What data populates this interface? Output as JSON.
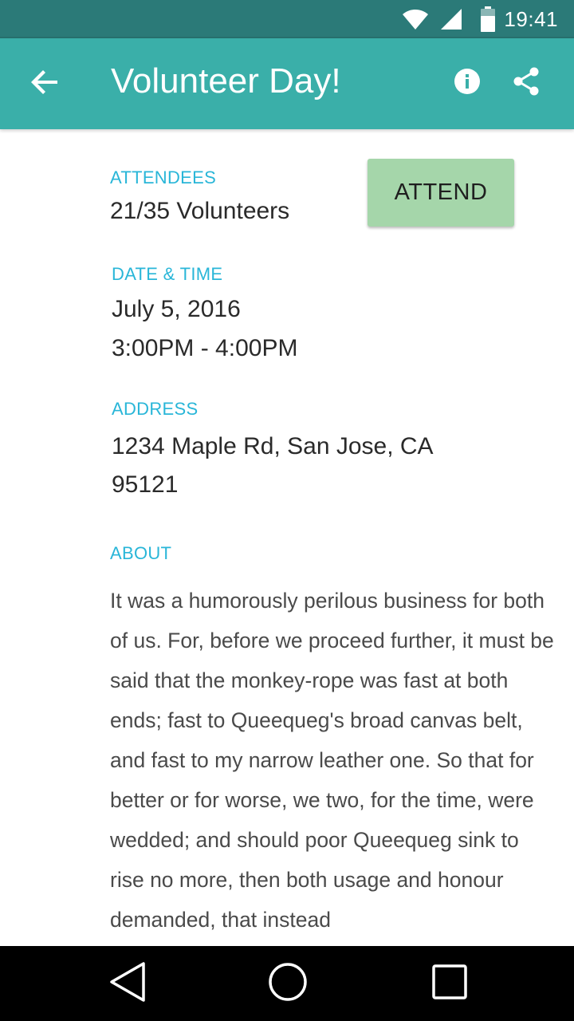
{
  "status_bar": {
    "time": "19:41",
    "icons": [
      "wifi-icon",
      "cell-signal-icon",
      "battery-icon"
    ],
    "background": "#2b7a78"
  },
  "app_bar": {
    "title": "Volunteer Day!",
    "background": "#3aafa9",
    "icons": [
      "arrow-back-icon",
      "info-icon",
      "share-icon"
    ]
  },
  "details": {
    "attendees": {
      "label": "ATTENDEES",
      "value": "21/35 Volunteers"
    },
    "attend_button": {
      "label": "ATTEND",
      "color": "#a5d6aa"
    },
    "date_time": {
      "label": "DATE & TIME",
      "date": "July 5, 2016",
      "time": "3:00PM - 4:00PM"
    },
    "address": {
      "label": "ADDRESS",
      "line1": "1234 Maple Rd, San Jose, CA",
      "line2": "95121"
    },
    "about": {
      "label": "ABOUT",
      "text": "It was a humorously perilous business for both of us. For, before we proceed further, it must be said that the monkey-rope was fast at both ends; fast to Queequeg's broad canvas belt, and fast to my narrow leather one. So that for better or for worse, we two, for the time, were wedded; and should poor Queequeg sink to rise no more, then both usage and honour demanded, that instead"
    },
    "label_color": "#29b6d8"
  },
  "nav_bar": {
    "icons": [
      "back-triangle-icon",
      "home-circle-icon",
      "recents-square-icon"
    ]
  }
}
